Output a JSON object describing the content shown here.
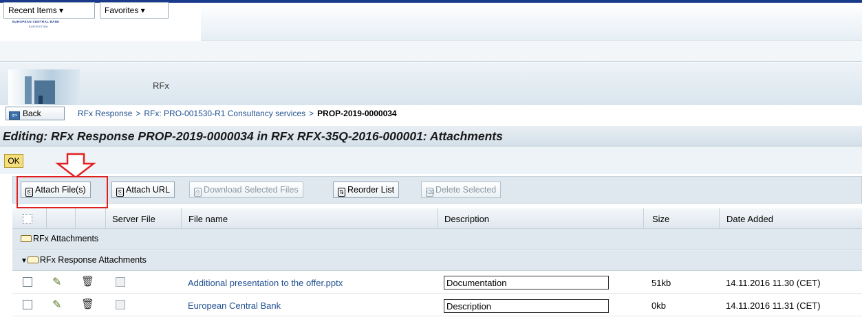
{
  "logo": {
    "name": "EUROPEAN CENTRAL BANK",
    "sub": "EUROSYSTEM"
  },
  "menu": {
    "recent_items": "Recent Items ▾",
    "favorites": "Favorites ▾"
  },
  "banner": {
    "title": "RFx"
  },
  "nav": {
    "back_label": "Back",
    "breadcrumbs": [
      "RFx Response",
      "RFx: PRO-001530-R1 Consultancy services",
      "PROP-2019-0000034"
    ],
    "separator": ">"
  },
  "page_title": "Editing: RFx Response PROP-2019-0000034 in RFx RFX-35Q-2016-000001: Attachments",
  "ok_label": "OK",
  "toolbar": {
    "attach_files": "Attach File(s)",
    "attach_url": "Attach URL",
    "download_selected": "Download Selected Files",
    "reorder_list": "Reorder List",
    "delete_selected": "Delete Selected"
  },
  "table": {
    "columns": [
      "Server File",
      "File name",
      "Description",
      "Size",
      "Date Added"
    ],
    "groups": [
      "RFx Attachments",
      "RFx Response Attachments"
    ],
    "rows": [
      {
        "file_name": "Additional presentation to the offer.pptx",
        "description": "Documentation",
        "size": "51kb",
        "date_added": "14.11.2016 11.30 (CET)"
      },
      {
        "file_name": "European Central Bank",
        "description": "Description",
        "size": "0kb",
        "date_added": "14.11.2016 11.31 (CET)"
      }
    ]
  },
  "colors": {
    "accent": "#1a3a8c",
    "link": "#1f4f8f",
    "highlight": "#e02020",
    "ok_button": "#f6df7a"
  }
}
